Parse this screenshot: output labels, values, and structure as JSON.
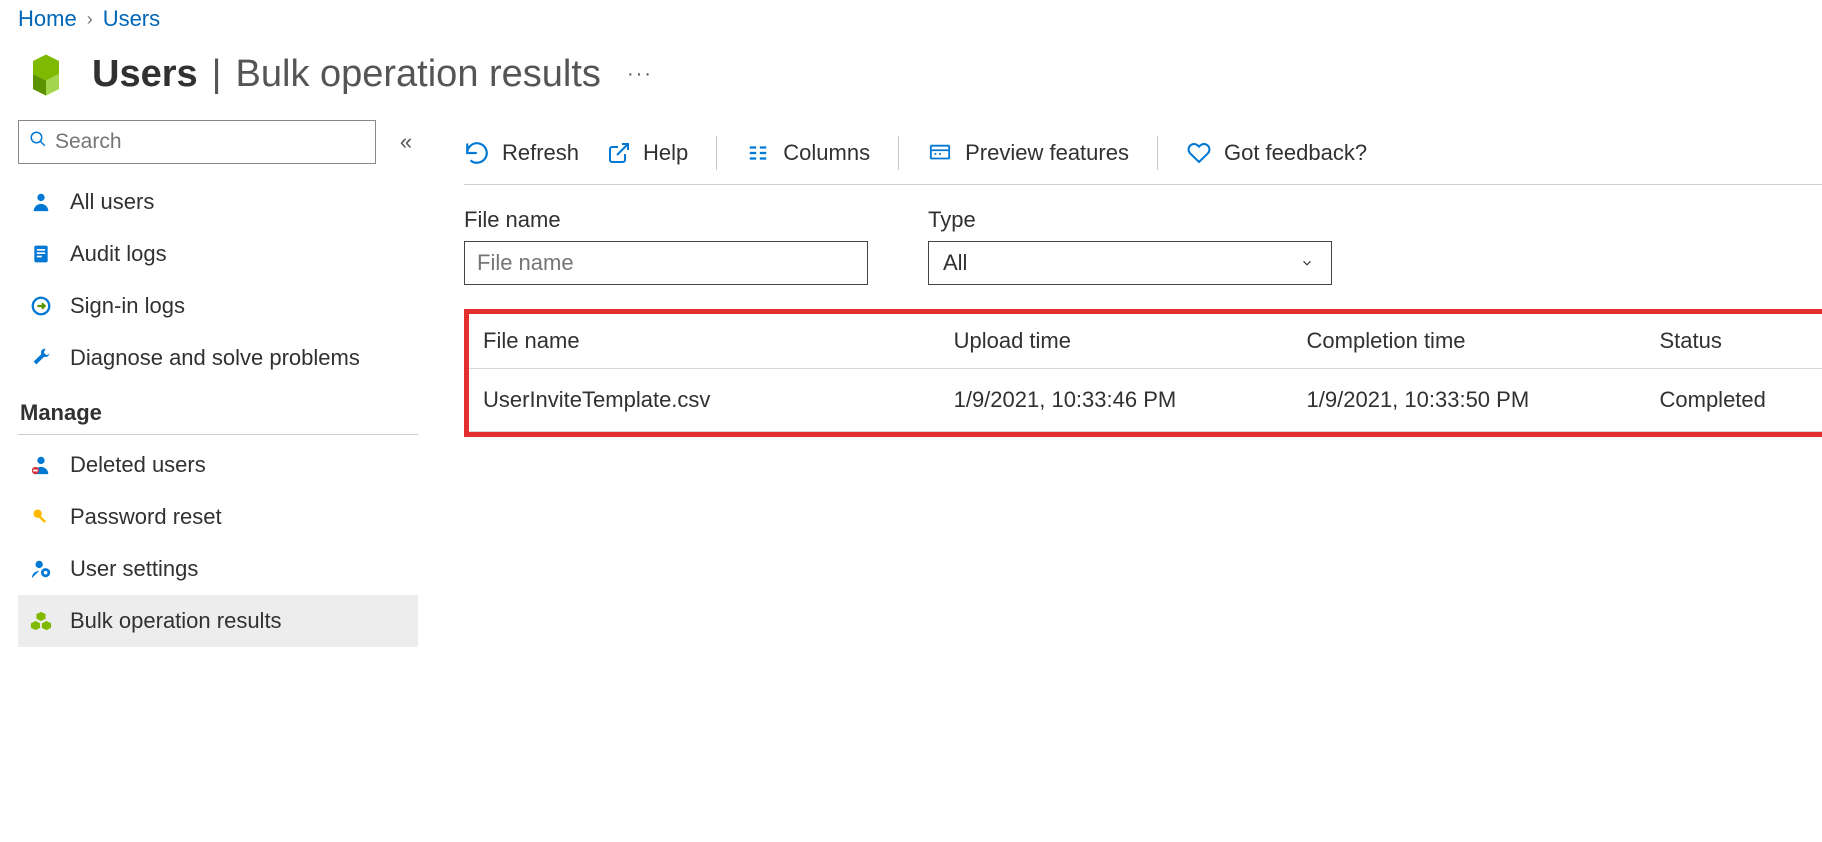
{
  "breadcrumb": {
    "home": "Home",
    "users": "Users"
  },
  "header": {
    "title_bold": "Users",
    "title_sep": "|",
    "title_light": "Bulk operation results",
    "ellipsis": "···"
  },
  "sidebar": {
    "search_placeholder": "Search",
    "items": {
      "all_users": "All users",
      "audit_logs": "Audit logs",
      "signin_logs": "Sign-in logs",
      "diagnose": "Diagnose and solve problems"
    },
    "section_manage": "Manage",
    "manage_items": {
      "deleted_users": "Deleted users",
      "password_reset": "Password reset",
      "user_settings": "User settings",
      "bulk_results": "Bulk operation results"
    }
  },
  "toolbar": {
    "refresh": "Refresh",
    "help": "Help",
    "columns": "Columns",
    "preview": "Preview features",
    "feedback": "Got feedback?"
  },
  "filters": {
    "filename_label": "File name",
    "filename_placeholder": "File name",
    "type_label": "Type",
    "type_value": "All"
  },
  "table": {
    "headers": {
      "file": "File name",
      "upload": "Upload time",
      "completion": "Completion time",
      "status": "Status"
    },
    "rows": [
      {
        "file": "UserInviteTemplate.csv",
        "upload": "1/9/2021, 10:33:46 PM",
        "completion": "1/9/2021, 10:33:50 PM",
        "status": "Completed"
      }
    ]
  }
}
